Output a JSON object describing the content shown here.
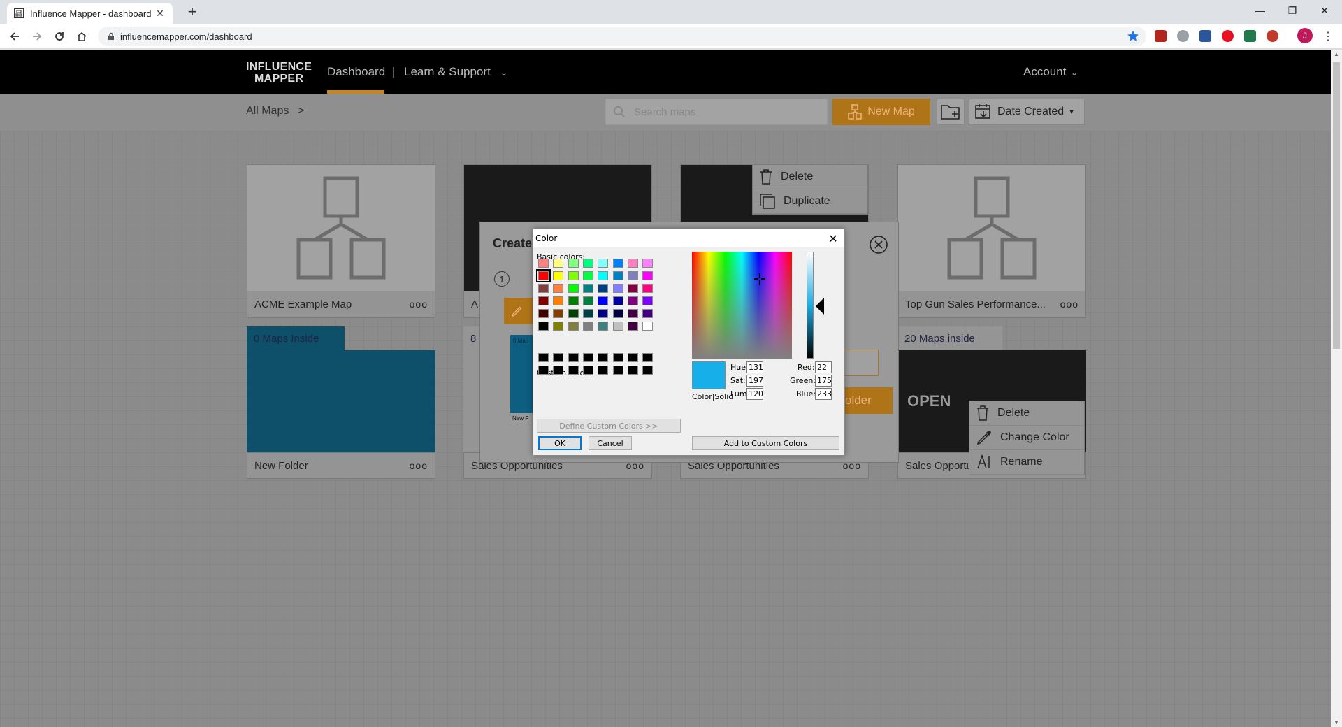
{
  "browser": {
    "tab_title": "Influence Mapper - dashboard",
    "url": "influencemapper.com/dashboard",
    "profile_initial": "J"
  },
  "header": {
    "logo_line1": "INFLUENCE",
    "logo_line2": "MAPPER",
    "nav_dashboard": "Dashboard",
    "nav_separator": "|",
    "nav_learn": "Learn & Support",
    "account": "Account"
  },
  "toolbar": {
    "breadcrumb": "All Maps",
    "breadcrumb_arrow": ">",
    "search_placeholder": "Search maps",
    "new_map": "New Map",
    "sort_label": "Date Created"
  },
  "cards": {
    "c1_name": "ACME Example Map",
    "c2_name": "A",
    "c4_name": "Top Gun Sales Performance...",
    "f1_count": "0 Maps Inside",
    "f1_name": "New Folder",
    "f2_count": "8",
    "f2_name": "Sales Opportunities",
    "f3_name": "Sales Opportunities",
    "f4_count": "20 Maps inside",
    "f4_name": "Sales Opportunities",
    "f4_open": "OPEN",
    "dots": "ooo"
  },
  "context_menu_top": {
    "delete": "Delete",
    "duplicate": "Duplicate"
  },
  "context_menu_bottom": {
    "delete": "Delete",
    "change_color": "Change Color",
    "rename": "Rename"
  },
  "modal": {
    "title": "Create",
    "step": "1",
    "preview_label": "0 Map",
    "preview_sub": "New F",
    "create_btn": "older"
  },
  "color_dialog": {
    "title": "Color",
    "basic_colors_label": "Basic colors:",
    "custom_colors_label": "Custom colors:",
    "define_custom": "Define Custom Colors >>",
    "ok": "OK",
    "cancel": "Cancel",
    "color_solid": "Color|Solid",
    "add_custom": "Add to Custom Colors",
    "hue_label": "Hue:",
    "sat_label": "Sat:",
    "lum_label": "Lum:",
    "red_label": "Red:",
    "green_label": "Green:",
    "blue_label": "Blue:",
    "hue": "131",
    "sat": "197",
    "lum": "120",
    "red": "22",
    "green": "175",
    "blue": "233",
    "selected_color": "#16afe9",
    "basic_colors": [
      "#ff8080",
      "#ffff80",
      "#80ff80",
      "#00ff80",
      "#80ffff",
      "#0080ff",
      "#ff80c0",
      "#ff80ff",
      "#ff0000",
      "#ffff00",
      "#80ff00",
      "#00ff40",
      "#00ffff",
      "#0080c0",
      "#8080c0",
      "#ff00ff",
      "#804040",
      "#ff8040",
      "#00ff00",
      "#008080",
      "#004080",
      "#8080ff",
      "#800040",
      "#ff0080",
      "#800000",
      "#ff8000",
      "#008000",
      "#008040",
      "#0000ff",
      "#0000a0",
      "#800080",
      "#8000ff",
      "#400000",
      "#804000",
      "#004000",
      "#004040",
      "#000080",
      "#000040",
      "#400040",
      "#400080",
      "#000000",
      "#808000",
      "#808040",
      "#808080",
      "#408080",
      "#c0c0c0",
      "#400040",
      "#ffffff"
    ]
  },
  "colors": {
    "accent": "#c8851a",
    "folder_blue": "#0e4f69"
  }
}
